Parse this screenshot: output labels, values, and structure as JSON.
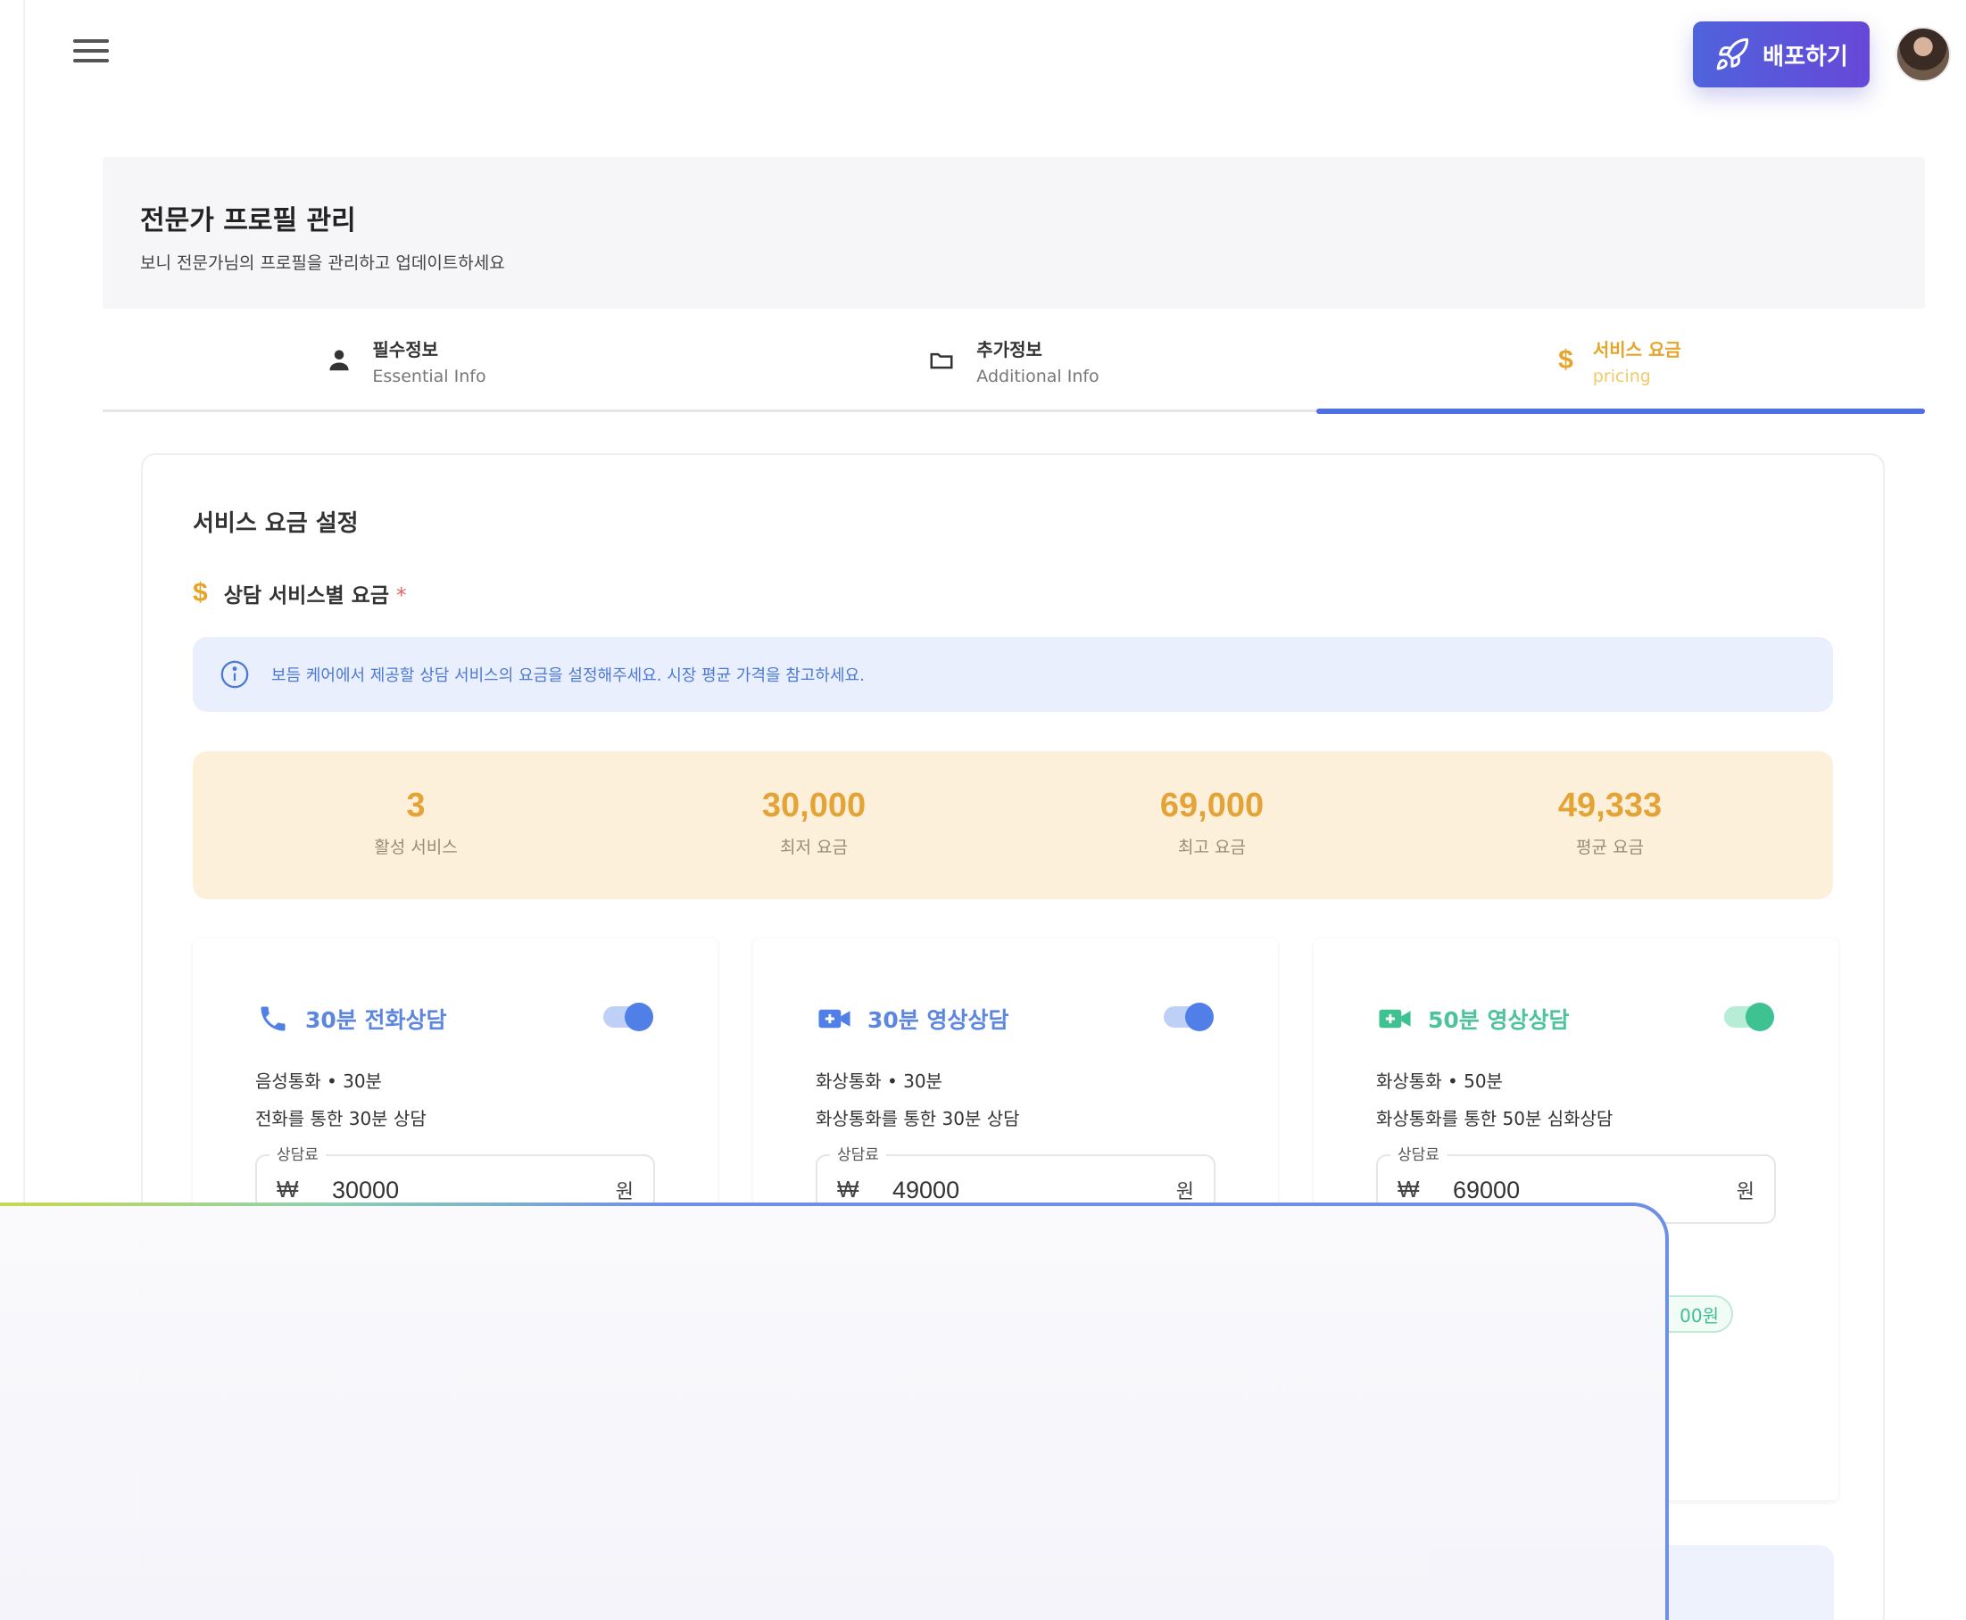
{
  "header": {
    "deploy_label": "배포하기"
  },
  "page": {
    "title": "전문가 프로필 관리",
    "subtitle": "보니 전문가님의 프로필을 관리하고 업데이트하세요"
  },
  "tabs": [
    {
      "label": "필수정보",
      "sub": "Essential Info",
      "icon": "person-icon",
      "active": false
    },
    {
      "label": "추가정보",
      "sub": "Additional Info",
      "icon": "folder-icon",
      "active": false
    },
    {
      "label": "서비스 요금",
      "sub": "pricing",
      "icon": "dollar-icon",
      "active": true
    }
  ],
  "pricing": {
    "section_title": "서비스 요금 설정",
    "heading": "상담 서비스별 요금",
    "required_mark": "*",
    "currency_icon": "$",
    "info_text": "보듬 케어에서 제공할 상담 서비스의 요금을 설정해주세요. 시장 평균 가격을 참고하세요."
  },
  "stats": [
    {
      "value": "3",
      "label": "활성 서비스"
    },
    {
      "value": "30,000",
      "label": "최저 요금"
    },
    {
      "value": "69,000",
      "label": "최고 요금"
    },
    {
      "value": "49,333",
      "label": "평균 요금"
    }
  ],
  "services": [
    {
      "name": "30분 전화상담",
      "type": "음성통화 • 30분",
      "desc": "전화를 통한 30분 상담",
      "fee_label": "상담료",
      "currency": "₩",
      "fee": "30000",
      "unit": "원",
      "enabled": true,
      "icon": "phone-icon",
      "color": "#5d86e0"
    },
    {
      "name": "30분 영상상담",
      "type": "화상통화 • 30분",
      "desc": "화상통화를 통한 30분 상담",
      "fee_label": "상담료",
      "currency": "₩",
      "fee": "49000",
      "unit": "원",
      "enabled": true,
      "icon": "video-icon",
      "color": "#5d86e0"
    },
    {
      "name": "50분 영상상담",
      "type": "화상통화 • 50분",
      "desc": "화상통화를 통한 50분 심화상담",
      "fee_label": "상담료",
      "currency": "₩",
      "fee": "69000",
      "unit": "원",
      "enabled": true,
      "icon": "video-icon",
      "color": "#4cc39a"
    }
  ],
  "badge": {
    "text": "00원"
  },
  "colors": {
    "accent": "#4f6fe6",
    "pricing_gold": "#e4a336",
    "green": "#3fc292"
  }
}
